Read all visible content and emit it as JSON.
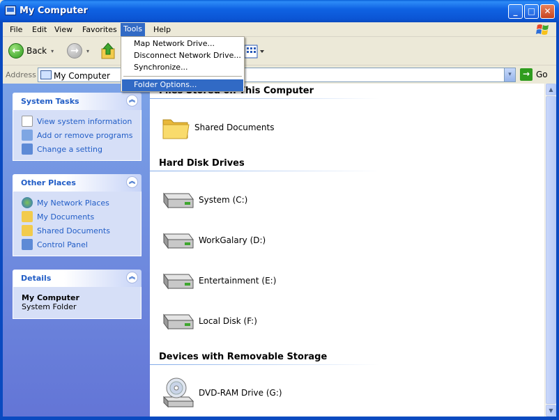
{
  "window": {
    "title": "My Computer",
    "controls": [
      "_",
      "□",
      "✕"
    ]
  },
  "menubar": [
    {
      "label": "File"
    },
    {
      "label": "Edit"
    },
    {
      "label": "View"
    },
    {
      "label": "Favorites"
    },
    {
      "label": "Tools"
    },
    {
      "label": "Help"
    }
  ],
  "tools_menu": {
    "items": [
      "Map Network Drive...",
      "Disconnect Network Drive...",
      "Synchronize...",
      "Folder Options..."
    ],
    "selected": "Folder Options..."
  },
  "toolbar": {
    "back_label": "Back",
    "back_glyph": "←",
    "forward_glyph": "→",
    "dropdown_glyph": "▾"
  },
  "address": {
    "label": "Address",
    "value": "My Computer",
    "go_label": "Go",
    "go_glyph": "→",
    "dropdown_glyph": "▾"
  },
  "taskpane": {
    "collapse_glyph": "︽",
    "system_tasks": {
      "title": "System Tasks",
      "links": [
        "View system information",
        "Add or remove programs",
        "Change a setting"
      ]
    },
    "other_places": {
      "title": "Other Places",
      "links": [
        "My Network Places",
        "My Documents",
        "Shared Documents",
        "Control Panel"
      ]
    },
    "details": {
      "title": "Details",
      "name": "My Computer",
      "type": "System Folder"
    }
  },
  "content": {
    "groups": [
      {
        "title": "Files Stored on This Computer",
        "items": [
          "Shared Documents"
        ]
      },
      {
        "title": "Hard Disk Drives",
        "items": [
          "System (C:)",
          "WorkGalary (D:)",
          "Entertainment (E:)",
          "Local Disk (F:)"
        ]
      },
      {
        "title": "Devices with Removable Storage",
        "items": [
          "DVD-RAM Drive (G:)"
        ]
      }
    ]
  },
  "scrollbar": {
    "up_glyph": "▲",
    "down_glyph": "▼"
  },
  "colors": {
    "title_blue": "#0B55D4",
    "menu_highlight": "#316AC5",
    "link_blue": "#215DC6",
    "pane_blue": "#6375D6"
  }
}
